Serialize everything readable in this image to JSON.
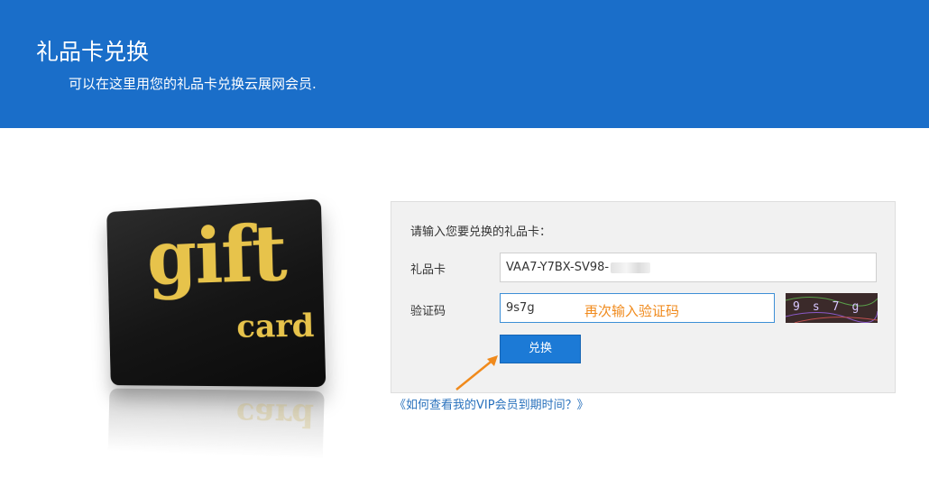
{
  "header": {
    "title": "礼品卡兑换",
    "subtitle": "可以在这里用您的礼品卡兑换云展网会员."
  },
  "card_image": {
    "word_gift": "gift",
    "word_card": "card"
  },
  "form": {
    "prompt": "请输入您要兑换的礼品卡：",
    "card_label": "礼品卡",
    "card_value": "VAA7-Y7BX-SV98-",
    "code_label": "验证码",
    "code_value": "9s7g",
    "captcha_text": "9s7g",
    "submit_label": "兑换"
  },
  "annotation": {
    "hint": "再次输入验证码",
    "arrow_color": "#f08a1c"
  },
  "vip_link": "《如何查看我的VIP会员到期时间？》",
  "colors": {
    "banner": "#1a6ec9",
    "button": "#1c7ad6",
    "link": "#2a72bd",
    "hint": "#f08a1c"
  }
}
